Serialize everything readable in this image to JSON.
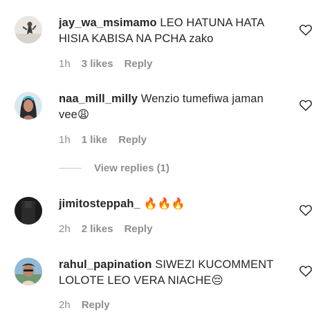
{
  "comments": [
    {
      "username": "jay_wa_msimamo",
      "text": "LEO HATUNA HATA HISIA KABISA NA PCHA zako",
      "time": "1h",
      "likes": "3 likes",
      "reply": "Reply"
    },
    {
      "username": "naa_mill_milly",
      "text": "Wenzio tumefiwa jaman vee😩",
      "time": "1h",
      "likes": "1 like",
      "reply": "Reply",
      "view_replies": "View replies (1)"
    },
    {
      "username": "jimitosteppah_",
      "text": "🔥🔥🔥",
      "time": "2h",
      "likes": "2 likes",
      "reply": "Reply"
    },
    {
      "username": "rahul_papination",
      "text": "SIWEZI KUCOMMENT LOLOTE LEO VERA NIACHE😔",
      "time": "2h",
      "likes": "",
      "reply": "Reply"
    }
  ],
  "icons": {
    "like": "heart-outline-icon"
  },
  "colors": {
    "text": "#262626",
    "meta": "#8e8e8e",
    "divider": "#c7c7c7"
  }
}
